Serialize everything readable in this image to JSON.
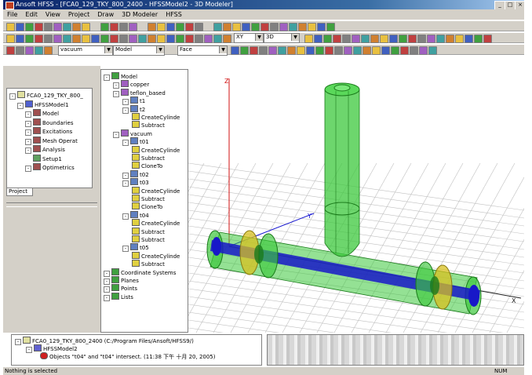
{
  "window": {
    "title": "Ansoft HFSS - [FCA0_129_TKY_800_2400 - HFSSModel2 - 3D Modeler]",
    "buttons": [
      "_",
      "□",
      "×"
    ]
  },
  "menu": [
    "File",
    "Edit",
    "View",
    "Project",
    "Draw",
    "3D Modeler",
    "HFSS"
  ],
  "toolbar3": {
    "material": "vacuum",
    "material_mode": "Model",
    "select_mode": "Face",
    "plane": "XY",
    "dimension": "3D"
  },
  "project_tree": {
    "items": [
      {
        "label": "FCA0_129_TKY_800_",
        "depth": 0
      },
      {
        "label": "HFSSModel1",
        "depth": 1
      },
      {
        "label": "Model",
        "depth": 2
      },
      {
        "label": "Boundaries",
        "depth": 2
      },
      {
        "label": "Excitations",
        "depth": 2
      },
      {
        "label": "Mesh Operat",
        "depth": 2
      },
      {
        "label": "Analysis",
        "depth": 2
      },
      {
        "label": "Setup1",
        "depth": 3
      },
      {
        "label": "Optimetrics",
        "depth": 2
      }
    ],
    "tab": "Project"
  },
  "model_tree": {
    "items": [
      {
        "label": "Model",
        "depth": 0
      },
      {
        "label": "copper",
        "depth": 1
      },
      {
        "label": "teflon_based",
        "depth": 1
      },
      {
        "label": "t1",
        "depth": 2
      },
      {
        "label": "t2",
        "depth": 2
      },
      {
        "label": "CreateCylinde",
        "depth": 3
      },
      {
        "label": "Subtract",
        "depth": 3
      },
      {
        "label": "vacuum",
        "depth": 1
      },
      {
        "label": "t01",
        "depth": 2
      },
      {
        "label": "CreateCylinde",
        "depth": 3
      },
      {
        "label": "Subtract",
        "depth": 3
      },
      {
        "label": "CloneTo",
        "depth": 3
      },
      {
        "label": "t02",
        "depth": 2
      },
      {
        "label": "t03",
        "depth": 2
      },
      {
        "label": "CreateCylinde",
        "depth": 3
      },
      {
        "label": "Subtract",
        "depth": 3
      },
      {
        "label": "CloneTo",
        "depth": 3
      },
      {
        "label": "t04",
        "depth": 2
      },
      {
        "label": "CreateCylinde",
        "depth": 3
      },
      {
        "label": "Subtract",
        "depth": 3
      },
      {
        "label": "Subtract",
        "depth": 3
      },
      {
        "label": "t05",
        "depth": 2
      },
      {
        "label": "CreateCylinde",
        "depth": 3
      },
      {
        "label": "Subtract",
        "depth": 3
      },
      {
        "label": "Coordinate Systems",
        "depth": 0
      },
      {
        "label": "Planes",
        "depth": 0
      },
      {
        "label": "Points",
        "depth": 0
      },
      {
        "label": "Lists",
        "depth": 0
      }
    ]
  },
  "viewport": {
    "axis_z": "Z",
    "axis_y": "Y",
    "axis_x": "X"
  },
  "message_panel": {
    "lines": [
      "FCA0_129_TKY_800_2400 (C:/Program Files/Ansoft/HFSS9/)",
      "HFSSModel2",
      "Objects \"t04\" and \"t04\" intersect. (11:38 下午 十月 20, 2005)"
    ]
  },
  "status": {
    "text": "Nothing is selected",
    "num": "NUM"
  },
  "colors": {
    "green_fill": "#3cc83c",
    "blue_core": "#1818c8",
    "yellow_ring": "#d8c020",
    "chrome": "#d4d0c8",
    "titlebar": "#0a246a"
  }
}
